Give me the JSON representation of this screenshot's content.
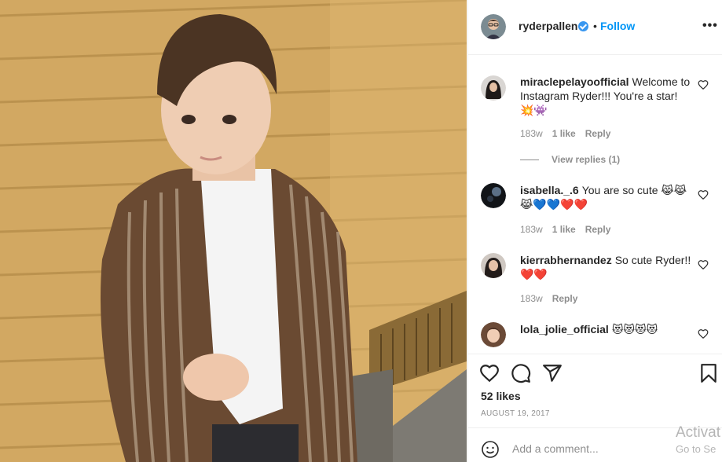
{
  "post": {
    "username": "ryderpallen",
    "separator": "•",
    "follow_label": "Follow",
    "more_label": "•••",
    "likes": "52 likes",
    "date": "AUGUST 19, 2017"
  },
  "comments": [
    {
      "username": "miraclepelayoofficial",
      "text": "Welcome to Instagram Ryder!!! You're a star!",
      "emoji": "💥👾",
      "age": "183w",
      "likes": "1 like",
      "reply_label": "Reply",
      "view_replies": "View replies (1)"
    },
    {
      "username": "isabella._.6",
      "text": "You are so cute",
      "emoji": "😹😹😹💙💙❤️❤️",
      "age": "183w",
      "likes": "1 like",
      "reply_label": "Reply"
    },
    {
      "username": "kierrabhernandez",
      "text": "So cute Ryder!!",
      "emoji": "❤️❤️",
      "age": "183w",
      "reply_label": "Reply"
    },
    {
      "username": "lola_jolie_official",
      "emoji": "😻😻😻😻"
    }
  ],
  "add_comment": {
    "placeholder": "Add a comment..."
  },
  "watermark": {
    "line1": "Activat",
    "line2": "Go to Se"
  },
  "icons": [
    "verified-badge-icon",
    "more-options-icon",
    "heart-icon",
    "comment-icon",
    "share-icon",
    "bookmark-icon",
    "emoji-icon"
  ],
  "colors": {
    "link_blue": "#0095f6",
    "verified_blue": "#3897f0",
    "muted_text": "#8e8e8e",
    "border": "#efefef"
  }
}
